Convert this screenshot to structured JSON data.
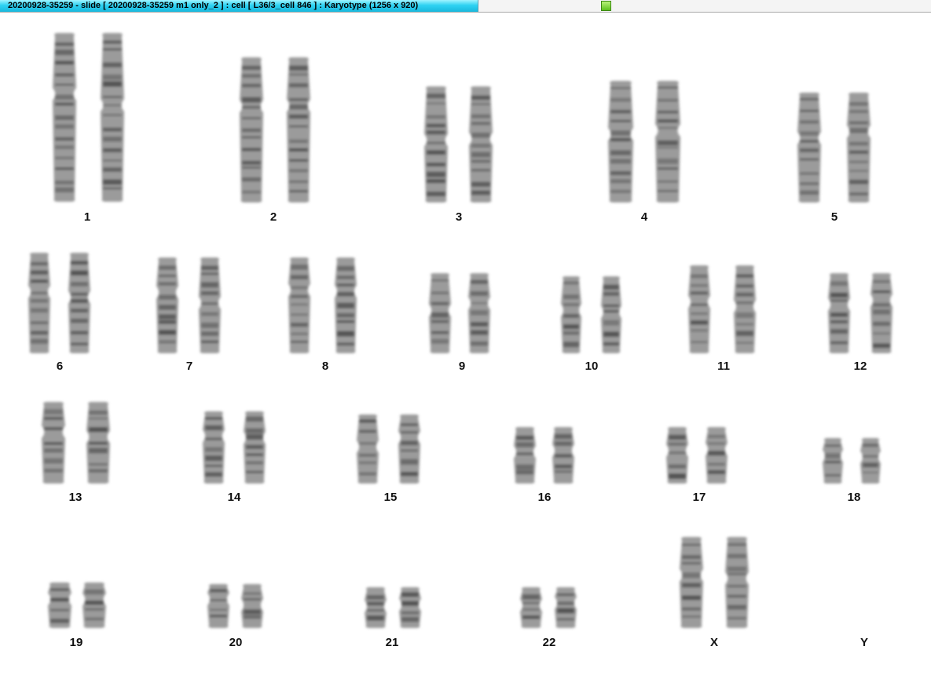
{
  "window": {
    "title": "20200928-35259 - slide [ 20200928-35259 m1 only_2 ] : cell [ L36/3_cell 846 ] : Karyotype  (1256 x 920)"
  },
  "colors": {
    "titlebar_accent": "#19b8dd",
    "status_indicator": "#5ec21d",
    "chromosome_fill": "#7a7a7a",
    "chromosome_band": "#3a3a3a"
  },
  "karyotype": [
    {
      "label": "1"
    },
    {
      "label": "2"
    },
    {
      "label": "3"
    },
    {
      "label": "4"
    },
    {
      "label": "5"
    },
    {
      "label": "6"
    },
    {
      "label": "7"
    },
    {
      "label": "8"
    },
    {
      "label": "9"
    },
    {
      "label": "10"
    },
    {
      "label": "11"
    },
    {
      "label": "12"
    },
    {
      "label": "13"
    },
    {
      "label": "14"
    },
    {
      "label": "15"
    },
    {
      "label": "16"
    },
    {
      "label": "17"
    },
    {
      "label": "18"
    },
    {
      "label": "19"
    },
    {
      "label": "20"
    },
    {
      "label": "21"
    },
    {
      "label": "22"
    },
    {
      "label": "X"
    },
    {
      "label": "Y"
    }
  ]
}
